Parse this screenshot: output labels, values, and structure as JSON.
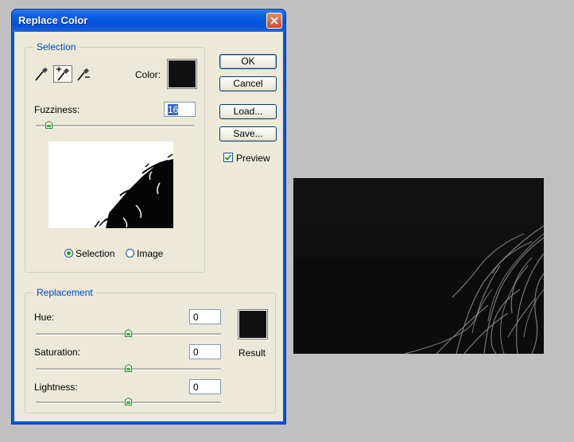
{
  "dialog": {
    "title": "Replace Color",
    "close_icon": "close-icon"
  },
  "selection": {
    "legend": "Selection",
    "color_label": "Color:",
    "color_value": "#0f0f0f",
    "tools": [
      "eyedropper-icon",
      "eyedropper-plus-icon",
      "eyedropper-minus-icon"
    ],
    "active_tool": 1,
    "fuzziness_label": "Fuzziness:",
    "fuzziness_value": "16",
    "fuzziness_slider_fraction": 0.08,
    "view_options": [
      "Selection",
      "Image"
    ],
    "view_selected": "Selection"
  },
  "buttons": {
    "ok": "OK",
    "cancel": "Cancel",
    "load": "Load...",
    "save": "Save..."
  },
  "preview": {
    "label": "Preview",
    "checked": true
  },
  "replacement": {
    "legend": "Replacement",
    "hue_label": "Hue:",
    "hue_value": "0",
    "saturation_label": "Saturation:",
    "saturation_value": "0",
    "lightness_label": "Lightness:",
    "lightness_value": "0",
    "result_label": "Result",
    "result_color": "#101010"
  }
}
